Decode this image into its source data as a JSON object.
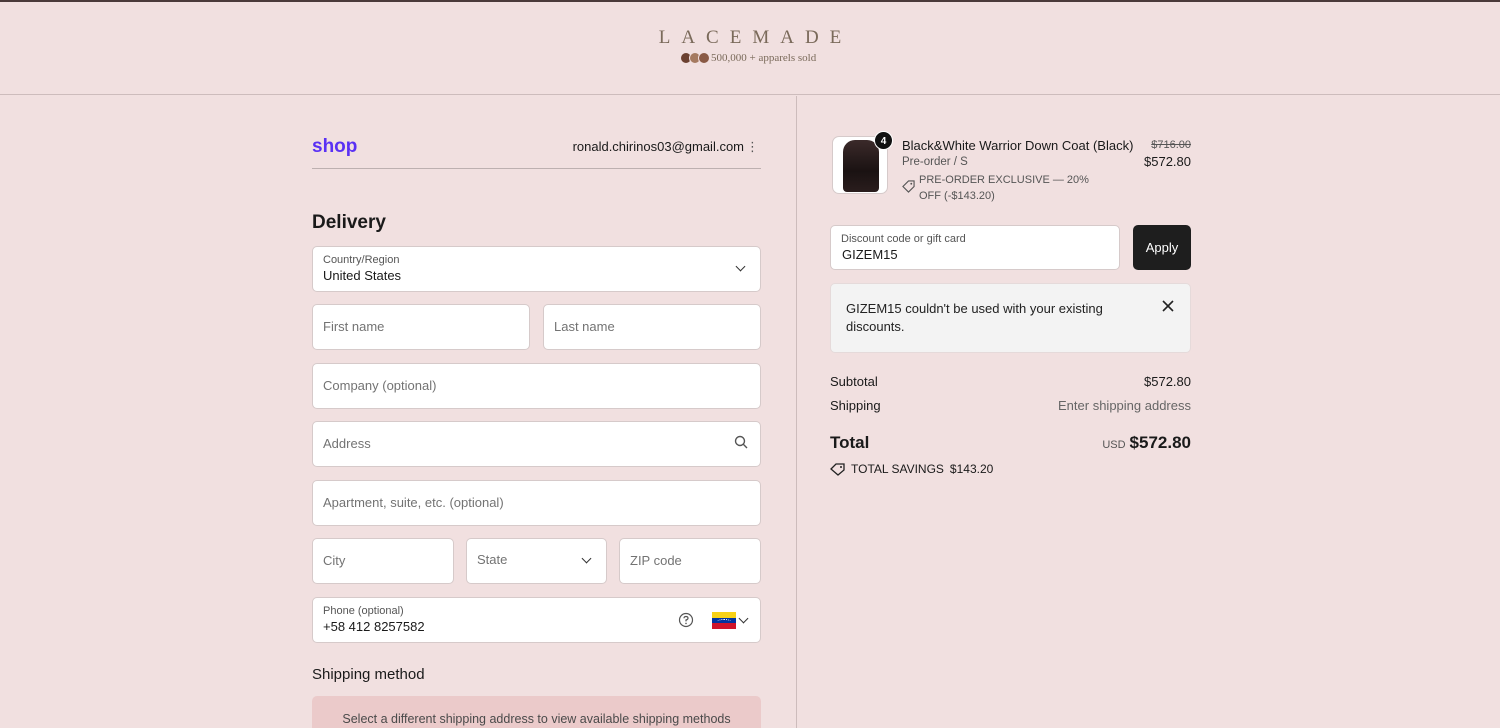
{
  "header": {
    "brand": "LACEMADE",
    "sold_text": "500,000 + apparels sold"
  },
  "account": {
    "shop_label": "shop",
    "email": "ronald.chirinos03@gmail.com",
    "menu_glyph": "⋮"
  },
  "delivery": {
    "title": "Delivery",
    "country_label": "Country/Region",
    "country_value": "United States",
    "first_name_placeholder": "First name",
    "last_name_placeholder": "Last name",
    "company_placeholder": "Company (optional)",
    "address_placeholder": "Address",
    "apartment_placeholder": "Apartment, suite, etc. (optional)",
    "city_placeholder": "City",
    "state_placeholder": "State",
    "zip_placeholder": "ZIP code",
    "phone_label": "Phone (optional)",
    "phone_value": "+58 412 8257582"
  },
  "shipping_method": {
    "title": "Shipping method",
    "note": "Select a different shipping address to view available shipping methods"
  },
  "cart": {
    "product": {
      "quantity": "4",
      "name": "Black&White Warrior Down Coat (Black)",
      "variant": "Pre-order / S",
      "promo": "PRE-ORDER EXCLUSIVE — 20% OFF (-$143.20)",
      "original_price": "$716.00",
      "price": "$572.80"
    },
    "discount": {
      "label": "Discount code or gift card",
      "value": "GIZEM15",
      "apply_label": "Apply",
      "error": "GIZEM15 couldn't be used with your existing discounts."
    },
    "summary": {
      "subtotal_label": "Subtotal",
      "subtotal_value": "$572.80",
      "shipping_label": "Shipping",
      "shipping_value": "Enter shipping address",
      "total_label": "Total",
      "currency": "USD",
      "total_value": "$572.80",
      "savings_label": "TOTAL SAVINGS",
      "savings_value": "$143.20"
    }
  },
  "colors": {
    "background": "#f1e0e0",
    "shop_purple": "#5a31f4",
    "apply_button": "#1e1e1e",
    "shipping_note_bg": "#ebcaca"
  }
}
